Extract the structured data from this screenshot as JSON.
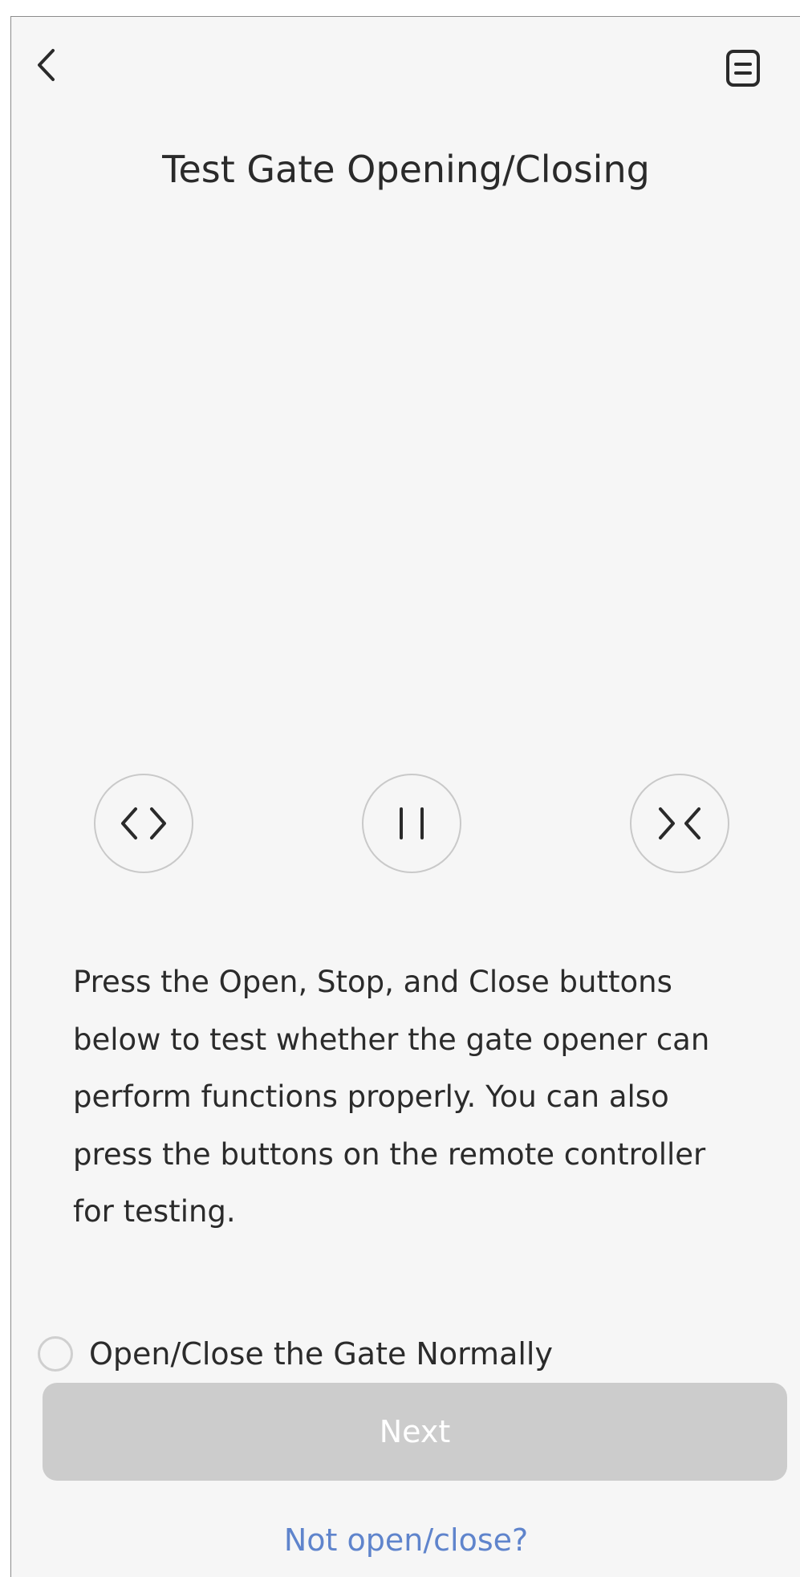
{
  "header": {
    "back_icon": "chevron-left-icon",
    "menu_icon": "document-list-icon",
    "title": "Test Gate Opening/Closing"
  },
  "controls": [
    {
      "id": "open",
      "icon": "open-arrows-icon",
      "glyph": "<>"
    },
    {
      "id": "stop",
      "icon": "pause-icon",
      "glyph": "II"
    },
    {
      "id": "close",
      "icon": "close-arrows-icon",
      "glyph": "><"
    }
  ],
  "instructions": {
    "text": "Press the Open, Stop, and Close buttons below to test whether the gate opener can perform functions properly. You can also press the buttons on the remote controller for testing."
  },
  "confirmation": {
    "label": "Open/Close the Gate Normally",
    "checked": false
  },
  "footer": {
    "next_label": "Next",
    "next_enabled": false,
    "help_link": "Not open/close?"
  },
  "colors": {
    "background": "#f6f6f6",
    "button_disabled": "#cccccc",
    "link": "#5f84cc",
    "text": "#2b2b2b"
  }
}
